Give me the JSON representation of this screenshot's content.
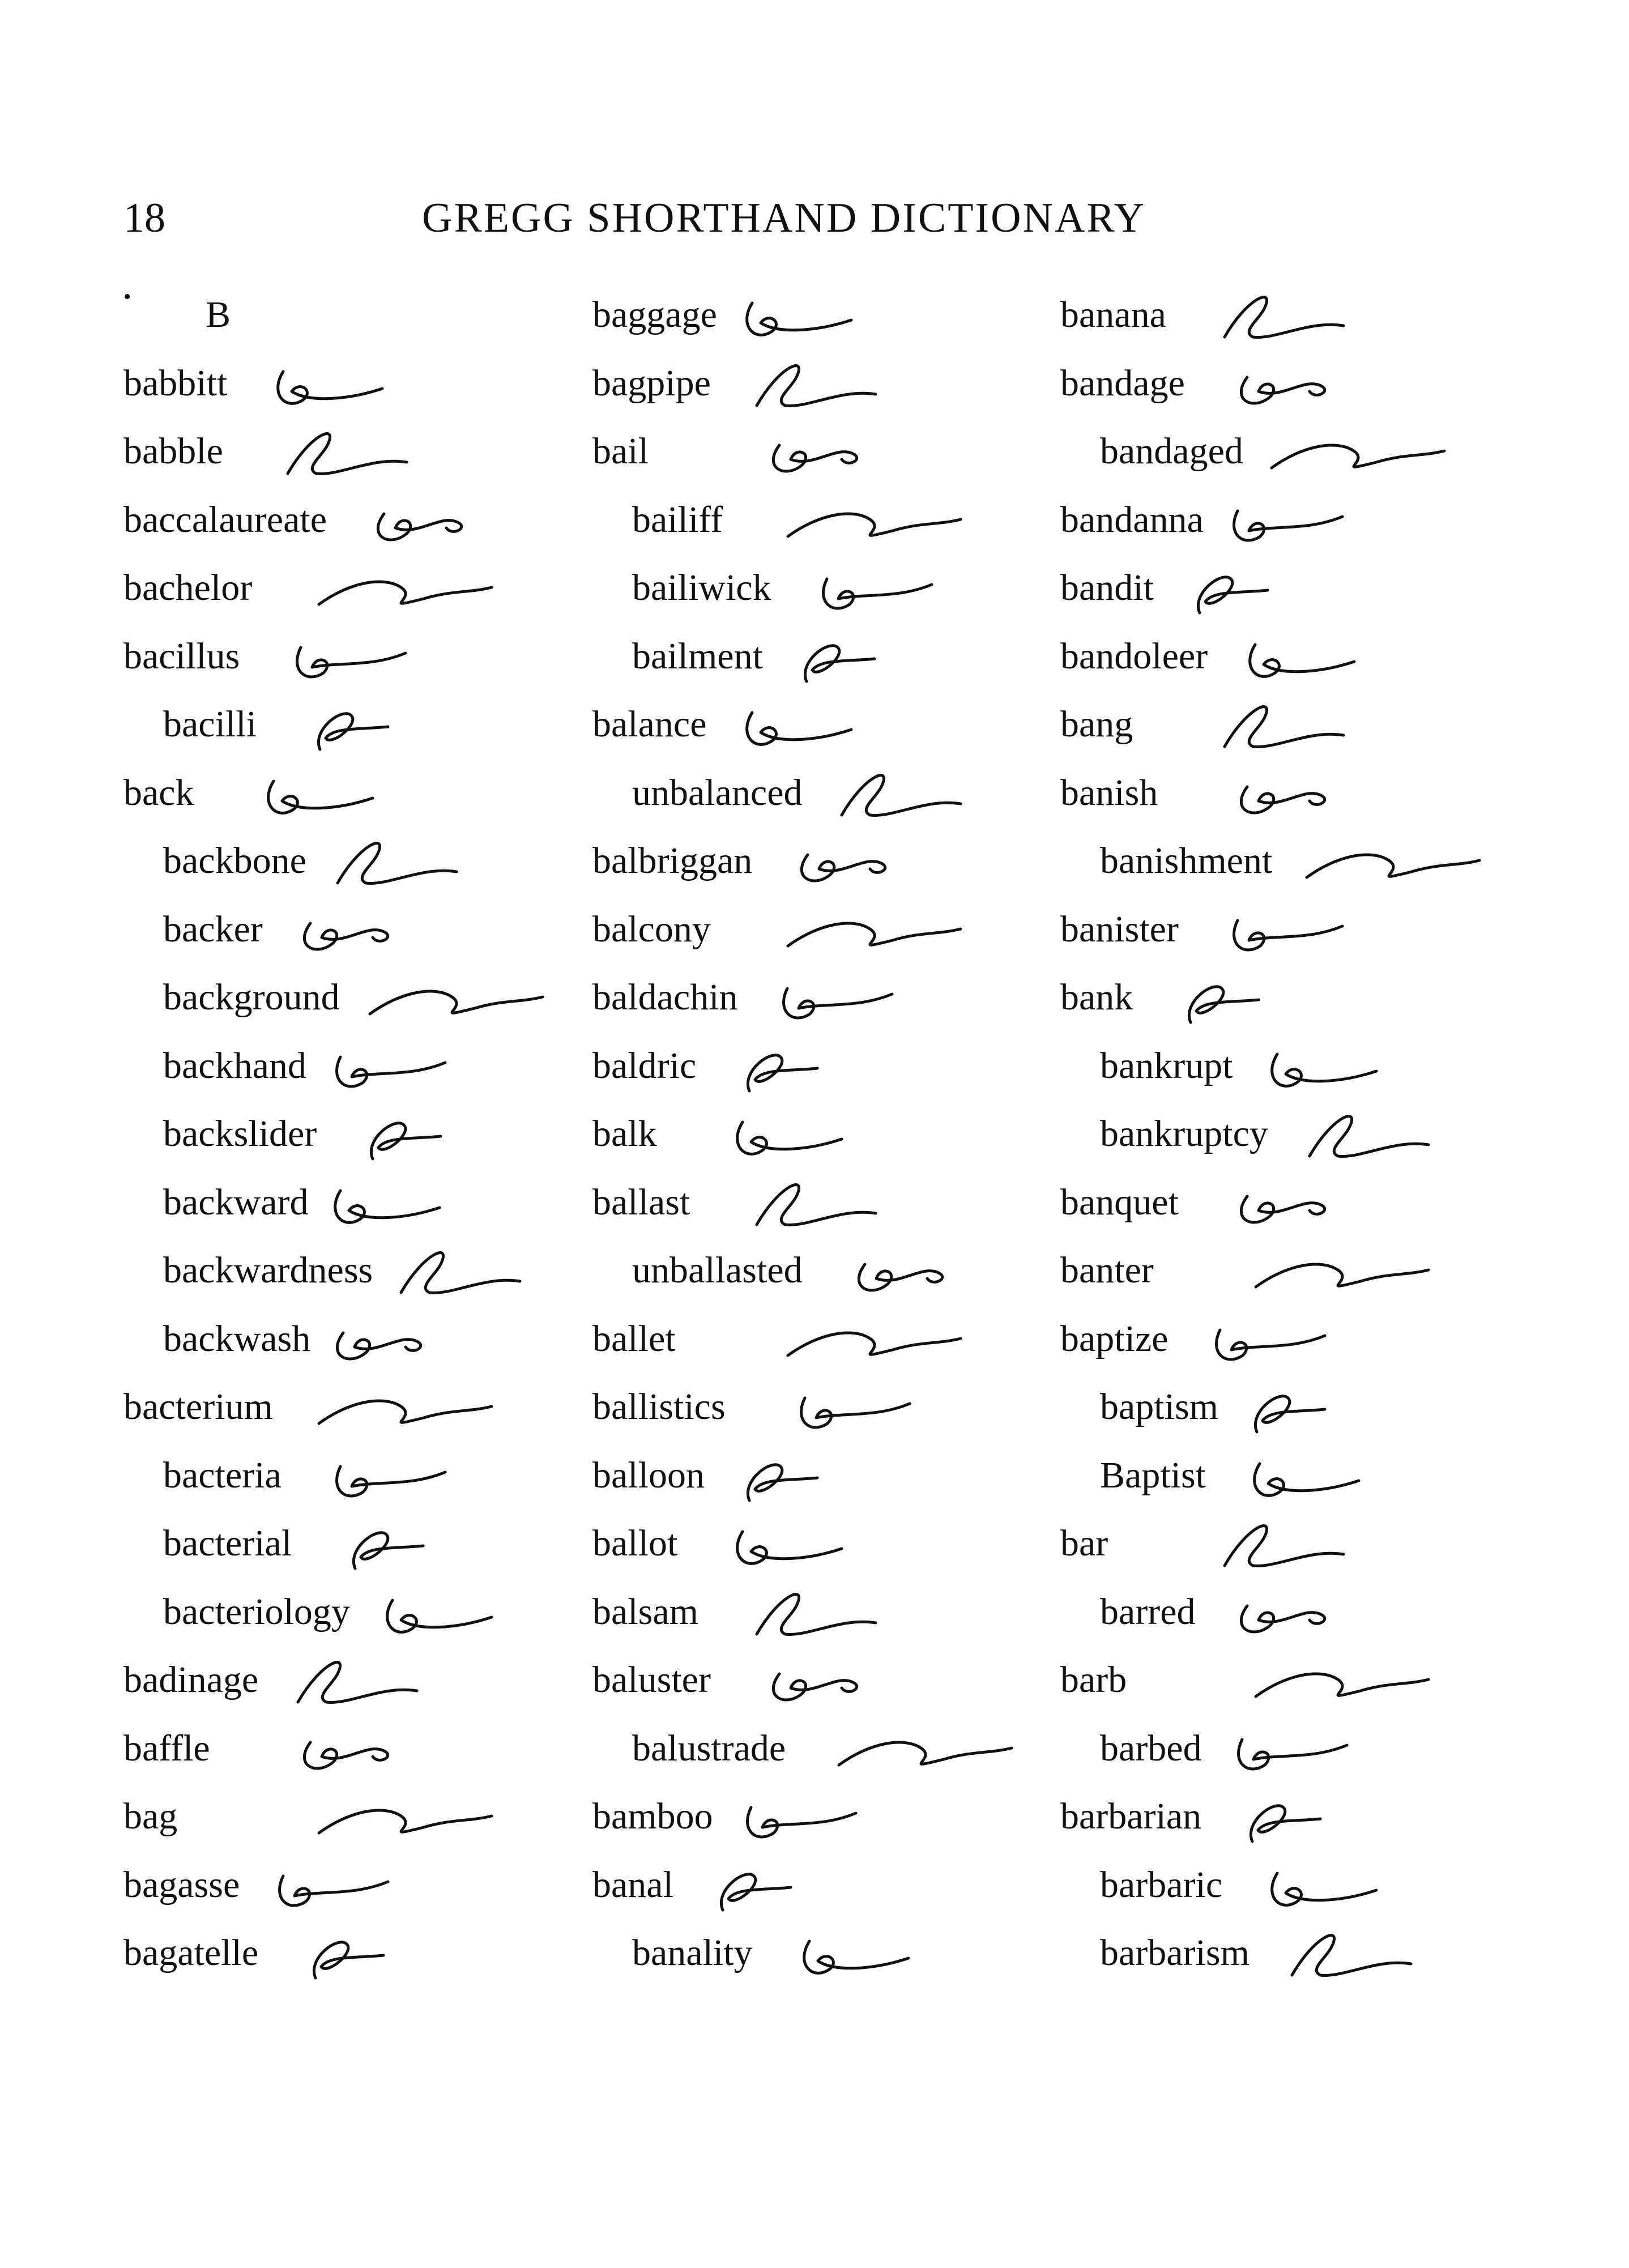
{
  "header": {
    "page_number": "18",
    "title": "GREGG SHORTHAND DICTIONARY"
  },
  "section_letter": "B",
  "columns": [
    {
      "entries": [
        {
          "word": "B",
          "kind": "section"
        },
        {
          "word": "babbitt",
          "kind": "head"
        },
        {
          "word": "babble",
          "kind": "head"
        },
        {
          "word": "baccalaureate",
          "kind": "head"
        },
        {
          "word": "bachelor",
          "kind": "head"
        },
        {
          "word": "bacillus",
          "kind": "head"
        },
        {
          "word": "bacilli",
          "kind": "sub"
        },
        {
          "word": "back",
          "kind": "head"
        },
        {
          "word": "backbone",
          "kind": "sub"
        },
        {
          "word": "backer",
          "kind": "sub"
        },
        {
          "word": "background",
          "kind": "sub"
        },
        {
          "word": "backhand",
          "kind": "sub"
        },
        {
          "word": "backslider",
          "kind": "sub"
        },
        {
          "word": "backward",
          "kind": "sub"
        },
        {
          "word": "backwardness",
          "kind": "sub"
        },
        {
          "word": "backwash",
          "kind": "sub"
        },
        {
          "word": "bacterium",
          "kind": "head"
        },
        {
          "word": "bacteria",
          "kind": "sub"
        },
        {
          "word": "bacterial",
          "kind": "sub"
        },
        {
          "word": "bacteriology",
          "kind": "sub"
        },
        {
          "word": "badinage",
          "kind": "head"
        },
        {
          "word": "baffle",
          "kind": "head"
        },
        {
          "word": "bag",
          "kind": "head"
        },
        {
          "word": "bagasse",
          "kind": "head"
        },
        {
          "word": "bagatelle",
          "kind": "head"
        }
      ]
    },
    {
      "entries": [
        {
          "word": "baggage",
          "kind": "head"
        },
        {
          "word": "bagpipe",
          "kind": "head"
        },
        {
          "word": "bail",
          "kind": "head"
        },
        {
          "word": "bailiff",
          "kind": "sub"
        },
        {
          "word": "bailiwick",
          "kind": "sub"
        },
        {
          "word": "bailment",
          "kind": "sub"
        },
        {
          "word": "balance",
          "kind": "head"
        },
        {
          "word": "unbalanced",
          "kind": "sub"
        },
        {
          "word": "balbriggan",
          "kind": "head"
        },
        {
          "word": "balcony",
          "kind": "head"
        },
        {
          "word": "baldachin",
          "kind": "head"
        },
        {
          "word": "baldric",
          "kind": "head"
        },
        {
          "word": "balk",
          "kind": "head"
        },
        {
          "word": "ballast",
          "kind": "head"
        },
        {
          "word": "unballasted",
          "kind": "sub"
        },
        {
          "word": "ballet",
          "kind": "head"
        },
        {
          "word": "ballistics",
          "kind": "head"
        },
        {
          "word": "balloon",
          "kind": "head"
        },
        {
          "word": "ballot",
          "kind": "head"
        },
        {
          "word": "balsam",
          "kind": "head"
        },
        {
          "word": "baluster",
          "kind": "head"
        },
        {
          "word": "balustrade",
          "kind": "sub"
        },
        {
          "word": "bamboo",
          "kind": "head"
        },
        {
          "word": "banal",
          "kind": "head"
        },
        {
          "word": "banality",
          "kind": "sub"
        }
      ]
    },
    {
      "entries": [
        {
          "word": "banana",
          "kind": "head"
        },
        {
          "word": "bandage",
          "kind": "head"
        },
        {
          "word": "bandaged",
          "kind": "sub"
        },
        {
          "word": "bandanna",
          "kind": "head"
        },
        {
          "word": "bandit",
          "kind": "head"
        },
        {
          "word": "bandoleer",
          "kind": "head"
        },
        {
          "word": "bang",
          "kind": "head"
        },
        {
          "word": "banish",
          "kind": "head"
        },
        {
          "word": "banishment",
          "kind": "sub"
        },
        {
          "word": "banister",
          "kind": "head"
        },
        {
          "word": "bank",
          "kind": "head"
        },
        {
          "word": "bankrupt",
          "kind": "sub"
        },
        {
          "word": "bankruptcy",
          "kind": "sub"
        },
        {
          "word": "banquet",
          "kind": "head"
        },
        {
          "word": "banter",
          "kind": "head"
        },
        {
          "word": "baptize",
          "kind": "head"
        },
        {
          "word": "baptism",
          "kind": "sub"
        },
        {
          "word": "Baptist",
          "kind": "sub"
        },
        {
          "word": "bar",
          "kind": "head"
        },
        {
          "word": "barred",
          "kind": "sub"
        },
        {
          "word": "barb",
          "kind": "head"
        },
        {
          "word": "barbed",
          "kind": "sub"
        },
        {
          "word": "barbarian",
          "kind": "head"
        },
        {
          "word": "barbaric",
          "kind": "sub"
        },
        {
          "word": "barbarism",
          "kind": "sub"
        }
      ]
    }
  ]
}
